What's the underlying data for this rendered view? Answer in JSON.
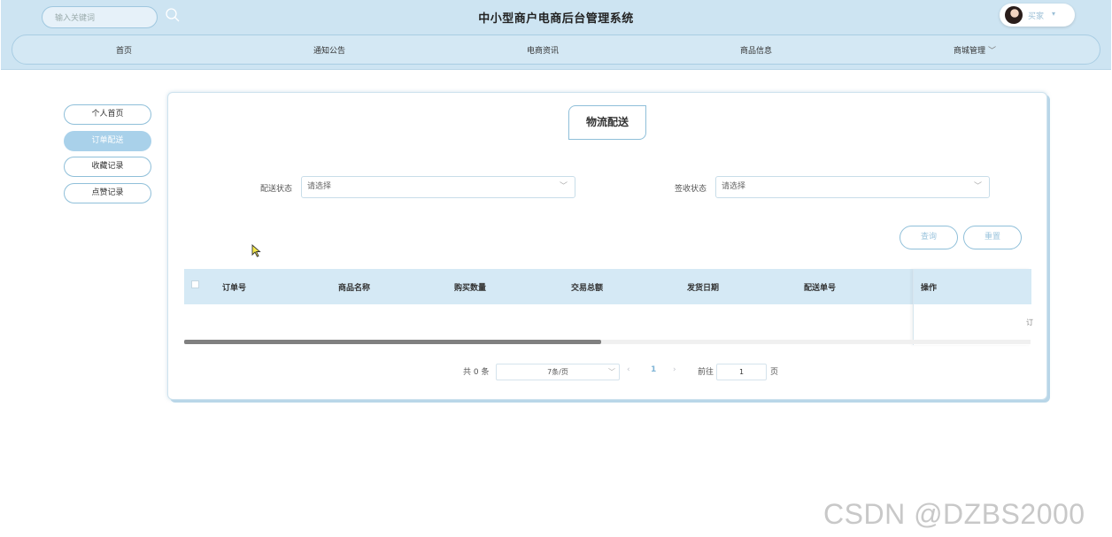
{
  "header": {
    "search_placeholder": "输入关键词",
    "site_title": "中小型商户电商后台管理系统",
    "user_name": "买家",
    "user_caret": "▾"
  },
  "nav": {
    "items": [
      {
        "label": "首页"
      },
      {
        "label": "通知公告"
      },
      {
        "label": "电商资讯"
      },
      {
        "label": "商品信息"
      },
      {
        "label": "商城管理"
      }
    ],
    "dropdown_chevron": "﹀"
  },
  "sidebar": {
    "items": [
      {
        "label": "个人首页",
        "active": false
      },
      {
        "label": "订单配送",
        "active": true
      },
      {
        "label": "收藏记录",
        "active": false
      },
      {
        "label": "点赞记录",
        "active": false
      }
    ]
  },
  "panel": {
    "title": "物流配送",
    "filters": [
      {
        "label": "配送状态",
        "placeholder": "请选择"
      },
      {
        "label": "签收状态",
        "placeholder": "请选择"
      }
    ],
    "buttons": {
      "query": "查询",
      "reset": "重置"
    },
    "table": {
      "columns": [
        "订单号",
        "商品名称",
        "购买数量",
        "交易总额",
        "发货日期",
        "配送单号"
      ],
      "operation_column": "操作",
      "operation_fragment": "订",
      "rows": []
    },
    "pagination": {
      "total": "共 0 条",
      "page_size": "7条/页",
      "current_page": "1",
      "goto_label": "前往",
      "goto_value": "1",
      "page_unit": "页"
    }
  },
  "watermark": "CSDN @DZBS2000",
  "colors": {
    "header_bg": "#cde4f2",
    "accent": "#8fbfd9",
    "active_sidebar": "#a9d1ea",
    "table_header": "#d5e9f5"
  }
}
